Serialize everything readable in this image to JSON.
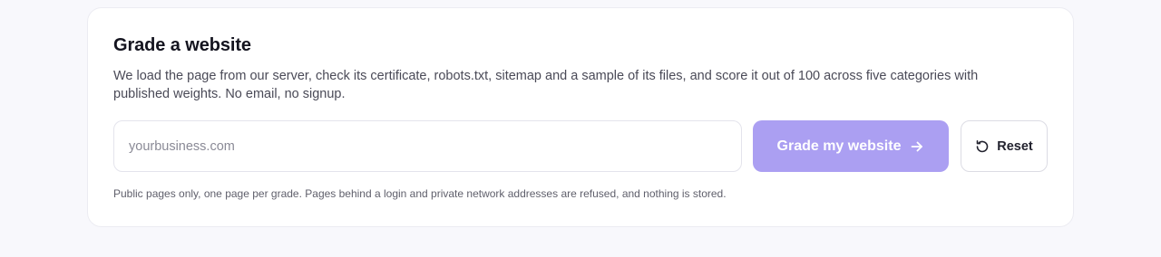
{
  "form": {
    "title": "Grade a website",
    "description": "We load the page from our server, check its certificate, robots.txt, sitemap and a sample of its files, and score it out of 100 across five categories with published weights. No email, no signup.",
    "url_input": {
      "value": "",
      "placeholder": "yourbusiness.com"
    },
    "grade_button": {
      "label": "Grade my website",
      "icon": "arrow-right-icon"
    },
    "reset_button": {
      "label": "Reset",
      "icon": "rotate-ccw-icon"
    },
    "note": "Public pages only, one page per grade. Pages behind a login and private network addresses are refused, and nothing is stored."
  },
  "colors": {
    "accent": "#ab9ff2",
    "background": "#f8f8fc",
    "card": "#ffffff",
    "title_text": "#14141f"
  }
}
